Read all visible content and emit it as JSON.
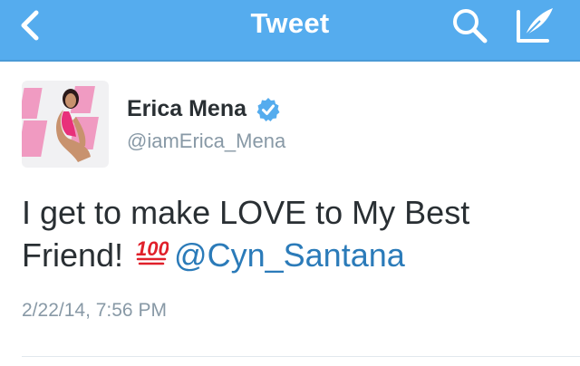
{
  "nav": {
    "title": "Tweet",
    "back_icon": "chevron-left-icon",
    "search_icon": "search-icon",
    "compose_icon": "compose-icon",
    "background_color": "#55acee"
  },
  "tweet": {
    "author": {
      "display_name": "Erica Mena",
      "handle": "@iamErica_Mena",
      "verified": true
    },
    "text_before_emoji": "I get to make LOVE to My Best Friend! ",
    "emoji": "hundred-points",
    "mention": "@Cyn_Santana",
    "timestamp": "2/22/14, 7:56 PM"
  },
  "colors": {
    "text": "#292f33",
    "muted": "#8899a6",
    "link": "#2b7bb9",
    "verified": "#55acee"
  }
}
